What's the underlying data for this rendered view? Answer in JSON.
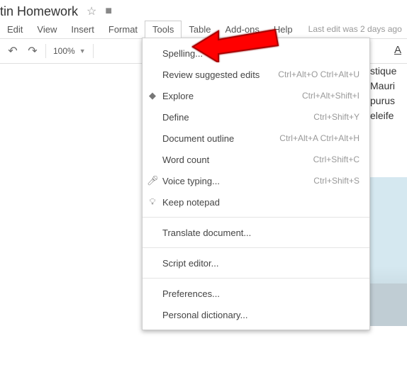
{
  "header": {
    "doc_title": "tin Homework",
    "last_edit": "Last edit was 2 days ago"
  },
  "menu": {
    "edit": "Edit",
    "view": "View",
    "insert": "Insert",
    "format": "Format",
    "tools": "Tools",
    "table": "Table",
    "addons": "Add-ons",
    "help": "Help"
  },
  "toolbar": {
    "zoom": "100%",
    "underline": "A"
  },
  "tools_menu": {
    "spelling": "Spelling...",
    "review_edits": "Review suggested edits",
    "review_edits_sc": "Ctrl+Alt+O Ctrl+Alt+U",
    "explore": "Explore",
    "explore_sc": "Ctrl+Alt+Shift+I",
    "define": "Define",
    "define_sc": "Ctrl+Shift+Y",
    "outline": "Document outline",
    "outline_sc": "Ctrl+Alt+A Ctrl+Alt+H",
    "word_count": "Word count",
    "word_count_sc": "Ctrl+Shift+C",
    "voice": "Voice typing...",
    "voice_sc": "Ctrl+Shift+S",
    "notepad": "Keep notepad",
    "translate": "Translate document...",
    "script": "Script editor...",
    "prefs": "Preferences...",
    "dictionary": "Personal dictionary..."
  },
  "doc": {
    "l1": "stique",
    "l2": "Mauri",
    "l3": "purus",
    "l4": "eleife"
  }
}
